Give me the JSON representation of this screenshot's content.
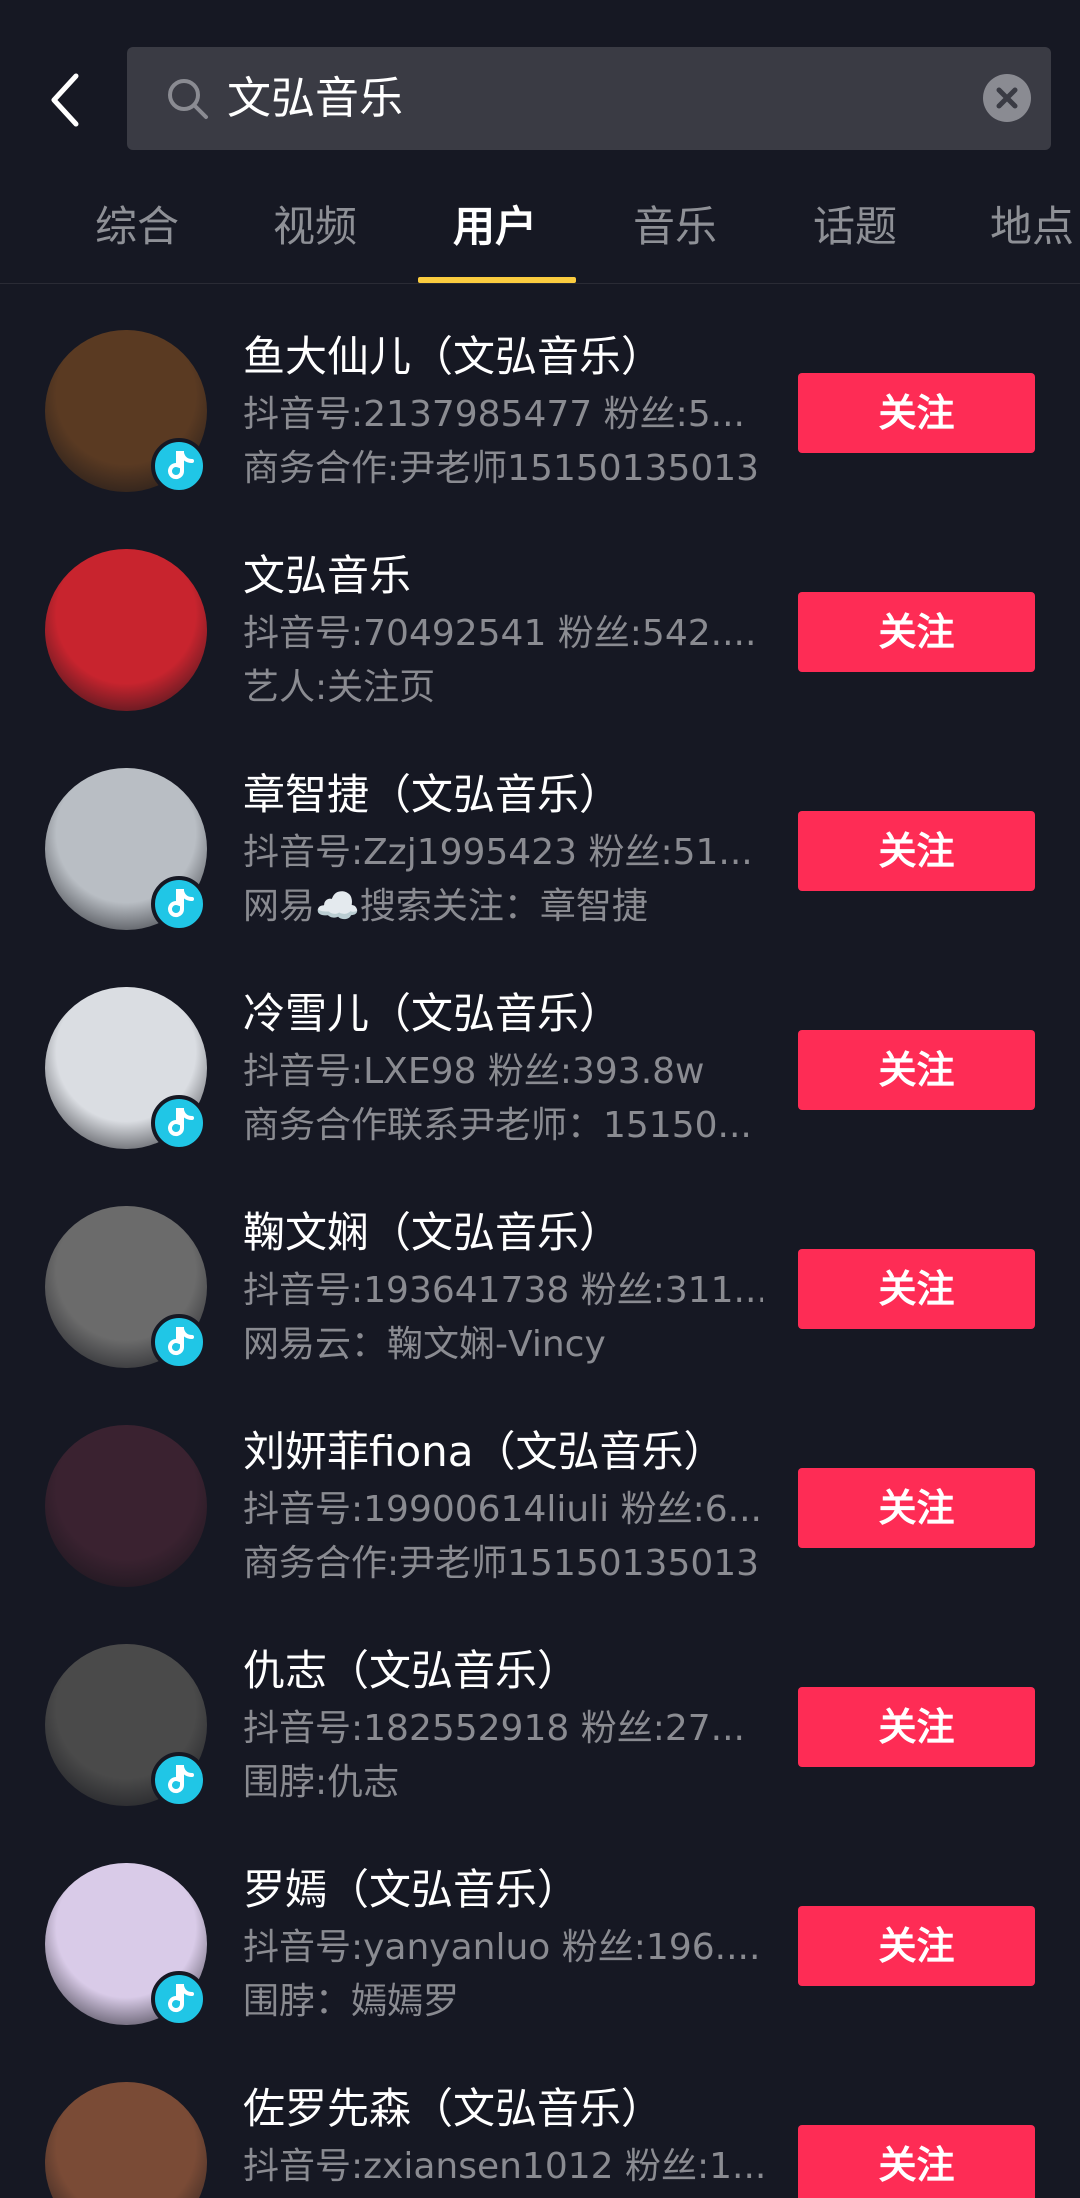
{
  "search": {
    "query": "文弘音乐"
  },
  "tabs": [
    {
      "label": "综合"
    },
    {
      "label": "视频"
    },
    {
      "label": "用户"
    },
    {
      "label": "音乐"
    },
    {
      "label": "话题"
    },
    {
      "label": "地点"
    }
  ],
  "active_tab": "用户",
  "users": [
    {
      "name": "鱼大仙儿（文弘音乐）",
      "meta": "抖音号:2137985477  粉丝:5...",
      "desc": "商务合作:尹老师15150135013",
      "follow_label": "关注",
      "avatar_color": "#5a3a22"
    },
    {
      "name": "文弘音乐",
      "meta": "抖音号:70492541  粉丝:542....",
      "desc": "艺人:关注页",
      "follow_label": "关注",
      "avatar_color": "#c8242e"
    },
    {
      "name": "章智捷（文弘音乐）",
      "meta": "抖音号:Zzj1995423  粉丝:51...",
      "desc": "网易☁️搜索关注：章智捷",
      "follow_label": "关注",
      "avatar_color": "#b9bec4"
    },
    {
      "name": "冷雪儿（文弘音乐）",
      "meta": "抖音号:LXE98  粉丝:393.8w",
      "desc": "商务合作联系尹老师：15150...",
      "follow_label": "关注",
      "avatar_color": "#dadde2"
    },
    {
      "name": "鞠文娴（文弘音乐）",
      "meta": "抖音号:193641738  粉丝:311...",
      "desc": "网易云：鞠文娴-Vincy",
      "follow_label": "关注",
      "avatar_color": "#6b6b6b"
    },
    {
      "name": "刘妍菲fiona（文弘音乐）",
      "meta": "抖音号:19900614liuli  粉丝:6...",
      "desc": "商务合作:尹老师15150135013",
      "follow_label": "关注",
      "avatar_color": "#3a2230"
    },
    {
      "name": "仇志（文弘音乐）",
      "meta": "抖音号:182552918  粉丝:27...",
      "desc": "围脖:仇志",
      "follow_label": "关注",
      "avatar_color": "#4a4a4a"
    },
    {
      "name": "罗嫣（文弘音乐）",
      "meta": "抖音号:yanyanluo  粉丝:196....",
      "desc": "围脖：嫣嫣罗",
      "follow_label": "关注",
      "avatar_color": "#d9cbe8"
    },
    {
      "name": "佐罗先森（文弘音乐）",
      "meta": "抖音号:zxiansen1012  粉丝:1...",
      "desc": "",
      "follow_label": "关注",
      "avatar_color": "#7a4b36"
    }
  ]
}
